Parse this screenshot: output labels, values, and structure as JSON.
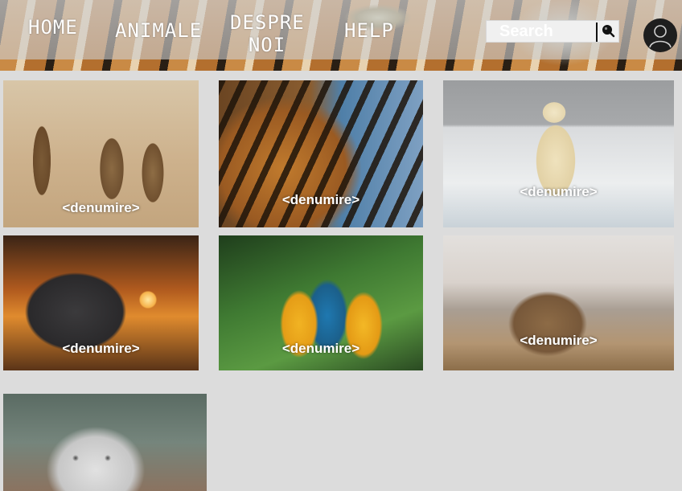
{
  "nav": {
    "items": [
      {
        "label": "HOME"
      },
      {
        "label": "ANIMALE"
      },
      {
        "label_line1": "DESPRE",
        "label_line2": "NOI"
      },
      {
        "label": "HELP"
      }
    ]
  },
  "search": {
    "placeholder": "Search"
  },
  "gallery": {
    "cards": [
      {
        "animal": "meerkats",
        "caption": "<denumire>"
      },
      {
        "animal": "tiger",
        "caption": "<denumire>"
      },
      {
        "animal": "polar bear",
        "caption": "<denumire>"
      },
      {
        "animal": "rhino",
        "caption": "<denumire>"
      },
      {
        "animal": "macaws",
        "caption": "<denumire>"
      },
      {
        "animal": "monkeys",
        "caption": "<denumire>"
      },
      {
        "animal": "snow leopard"
      }
    ]
  },
  "icons": {
    "search": "search-icon",
    "user": "user-icon"
  },
  "colors": {
    "page_background": "#dcdcdc",
    "caption_text": "#ffffff",
    "nav_text": "#ffffff"
  }
}
